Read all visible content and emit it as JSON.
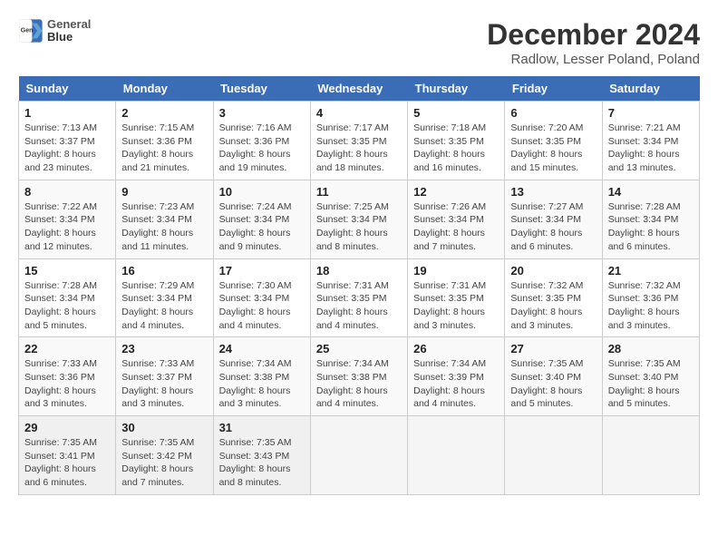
{
  "header": {
    "logo_line1": "General",
    "logo_line2": "Blue",
    "title": "December 2024",
    "subtitle": "Radlow, Lesser Poland, Poland"
  },
  "days_of_week": [
    "Sunday",
    "Monday",
    "Tuesday",
    "Wednesday",
    "Thursday",
    "Friday",
    "Saturday"
  ],
  "weeks": [
    [
      {
        "day": "1",
        "sunrise": "7:13 AM",
        "sunset": "3:37 PM",
        "daylight": "8 hours and 23 minutes."
      },
      {
        "day": "2",
        "sunrise": "7:15 AM",
        "sunset": "3:36 PM",
        "daylight": "8 hours and 21 minutes."
      },
      {
        "day": "3",
        "sunrise": "7:16 AM",
        "sunset": "3:36 PM",
        "daylight": "8 hours and 19 minutes."
      },
      {
        "day": "4",
        "sunrise": "7:17 AM",
        "sunset": "3:35 PM",
        "daylight": "8 hours and 18 minutes."
      },
      {
        "day": "5",
        "sunrise": "7:18 AM",
        "sunset": "3:35 PM",
        "daylight": "8 hours and 16 minutes."
      },
      {
        "day": "6",
        "sunrise": "7:20 AM",
        "sunset": "3:35 PM",
        "daylight": "8 hours and 15 minutes."
      },
      {
        "day": "7",
        "sunrise": "7:21 AM",
        "sunset": "3:34 PM",
        "daylight": "8 hours and 13 minutes."
      }
    ],
    [
      {
        "day": "8",
        "sunrise": "7:22 AM",
        "sunset": "3:34 PM",
        "daylight": "8 hours and 12 minutes."
      },
      {
        "day": "9",
        "sunrise": "7:23 AM",
        "sunset": "3:34 PM",
        "daylight": "8 hours and 11 minutes."
      },
      {
        "day": "10",
        "sunrise": "7:24 AM",
        "sunset": "3:34 PM",
        "daylight": "8 hours and 9 minutes."
      },
      {
        "day": "11",
        "sunrise": "7:25 AM",
        "sunset": "3:34 PM",
        "daylight": "8 hours and 8 minutes."
      },
      {
        "day": "12",
        "sunrise": "7:26 AM",
        "sunset": "3:34 PM",
        "daylight": "8 hours and 7 minutes."
      },
      {
        "day": "13",
        "sunrise": "7:27 AM",
        "sunset": "3:34 PM",
        "daylight": "8 hours and 6 minutes."
      },
      {
        "day": "14",
        "sunrise": "7:28 AM",
        "sunset": "3:34 PM",
        "daylight": "8 hours and 6 minutes."
      }
    ],
    [
      {
        "day": "15",
        "sunrise": "7:28 AM",
        "sunset": "3:34 PM",
        "daylight": "8 hours and 5 minutes."
      },
      {
        "day": "16",
        "sunrise": "7:29 AM",
        "sunset": "3:34 PM",
        "daylight": "8 hours and 4 minutes."
      },
      {
        "day": "17",
        "sunrise": "7:30 AM",
        "sunset": "3:34 PM",
        "daylight": "8 hours and 4 minutes."
      },
      {
        "day": "18",
        "sunrise": "7:31 AM",
        "sunset": "3:35 PM",
        "daylight": "8 hours and 4 minutes."
      },
      {
        "day": "19",
        "sunrise": "7:31 AM",
        "sunset": "3:35 PM",
        "daylight": "8 hours and 3 minutes."
      },
      {
        "day": "20",
        "sunrise": "7:32 AM",
        "sunset": "3:35 PM",
        "daylight": "8 hours and 3 minutes."
      },
      {
        "day": "21",
        "sunrise": "7:32 AM",
        "sunset": "3:36 PM",
        "daylight": "8 hours and 3 minutes."
      }
    ],
    [
      {
        "day": "22",
        "sunrise": "7:33 AM",
        "sunset": "3:36 PM",
        "daylight": "8 hours and 3 minutes."
      },
      {
        "day": "23",
        "sunrise": "7:33 AM",
        "sunset": "3:37 PM",
        "daylight": "8 hours and 3 minutes."
      },
      {
        "day": "24",
        "sunrise": "7:34 AM",
        "sunset": "3:38 PM",
        "daylight": "8 hours and 3 minutes."
      },
      {
        "day": "25",
        "sunrise": "7:34 AM",
        "sunset": "3:38 PM",
        "daylight": "8 hours and 4 minutes."
      },
      {
        "day": "26",
        "sunrise": "7:34 AM",
        "sunset": "3:39 PM",
        "daylight": "8 hours and 4 minutes."
      },
      {
        "day": "27",
        "sunrise": "7:35 AM",
        "sunset": "3:40 PM",
        "daylight": "8 hours and 5 minutes."
      },
      {
        "day": "28",
        "sunrise": "7:35 AM",
        "sunset": "3:40 PM",
        "daylight": "8 hours and 5 minutes."
      }
    ],
    [
      {
        "day": "29",
        "sunrise": "7:35 AM",
        "sunset": "3:41 PM",
        "daylight": "8 hours and 6 minutes."
      },
      {
        "day": "30",
        "sunrise": "7:35 AM",
        "sunset": "3:42 PM",
        "daylight": "8 hours and 7 minutes."
      },
      {
        "day": "31",
        "sunrise": "7:35 AM",
        "sunset": "3:43 PM",
        "daylight": "8 hours and 8 minutes."
      },
      null,
      null,
      null,
      null
    ]
  ],
  "labels": {
    "sunrise": "Sunrise:",
    "sunset": "Sunset:",
    "daylight": "Daylight:"
  }
}
